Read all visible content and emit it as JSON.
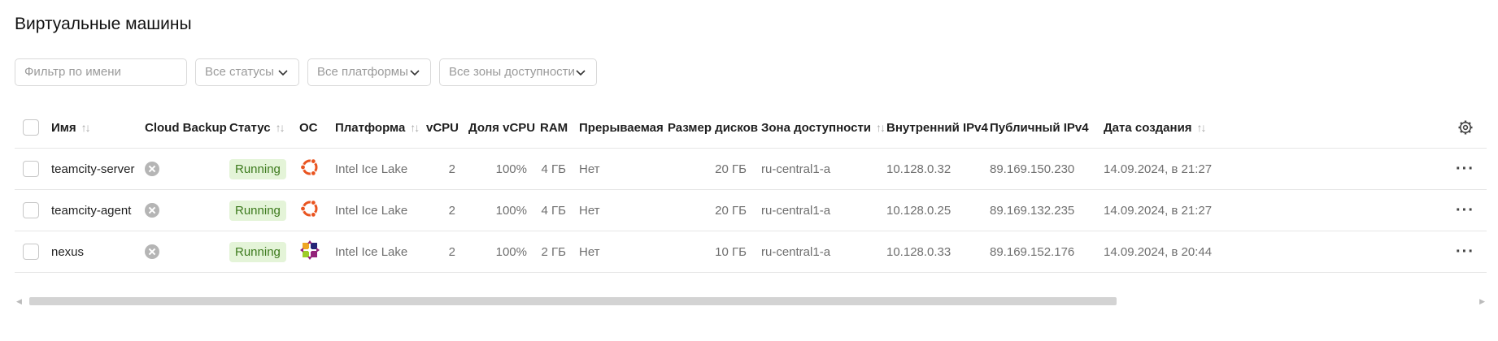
{
  "page": {
    "title": "Виртуальные машины"
  },
  "filters": {
    "name_placeholder": "Фильтр по имени",
    "status": "Все статусы",
    "platform": "Все платформы",
    "zone": "Все зоны доступности"
  },
  "columns": {
    "name": "Имя",
    "backup": "Cloud Backup",
    "status": "Статус",
    "os": "ОС",
    "platform": "Платформа",
    "vcpu": "vCPU",
    "vcpu_share": "Доля vCPU",
    "ram": "RAM",
    "preemptible": "Прерываемая",
    "disk_size": "Размер дисков",
    "zone": "Зона доступности",
    "internal_ip": "Внутренний IPv4",
    "public_ip": "Публичный IPv4",
    "created": "Дата создания"
  },
  "rows": [
    {
      "name": "teamcity-server",
      "status": "Running",
      "os_icon": "ubuntu-icon",
      "platform": "Intel Ice Lake",
      "vcpu": "2",
      "vcpu_share": "100%",
      "ram": "4 ГБ",
      "preemptible": "Нет",
      "disk_size": "20 ГБ",
      "zone": "ru-central1-a",
      "internal_ip": "10.128.0.32",
      "public_ip": "89.169.150.230",
      "created": "14.09.2024, в 21:27"
    },
    {
      "name": "teamcity-agent",
      "status": "Running",
      "os_icon": "ubuntu-icon",
      "platform": "Intel Ice Lake",
      "vcpu": "2",
      "vcpu_share": "100%",
      "ram": "4 ГБ",
      "preemptible": "Нет",
      "disk_size": "20 ГБ",
      "zone": "ru-central1-a",
      "internal_ip": "10.128.0.25",
      "public_ip": "89.169.132.235",
      "created": "14.09.2024, в 21:27"
    },
    {
      "name": "nexus",
      "status": "Running",
      "os_icon": "centos-icon",
      "platform": "Intel Ice Lake",
      "vcpu": "2",
      "vcpu_share": "100%",
      "ram": "2 ГБ",
      "preemptible": "Нет",
      "disk_size": "10 ГБ",
      "zone": "ru-central1-a",
      "internal_ip": "10.128.0.33",
      "public_ip": "89.169.152.176",
      "created": "14.09.2024, в 20:44"
    }
  ],
  "colors": {
    "running_bg": "#e4f4d8",
    "running_text": "#3c7a1c",
    "ubuntu": "#e95420"
  }
}
